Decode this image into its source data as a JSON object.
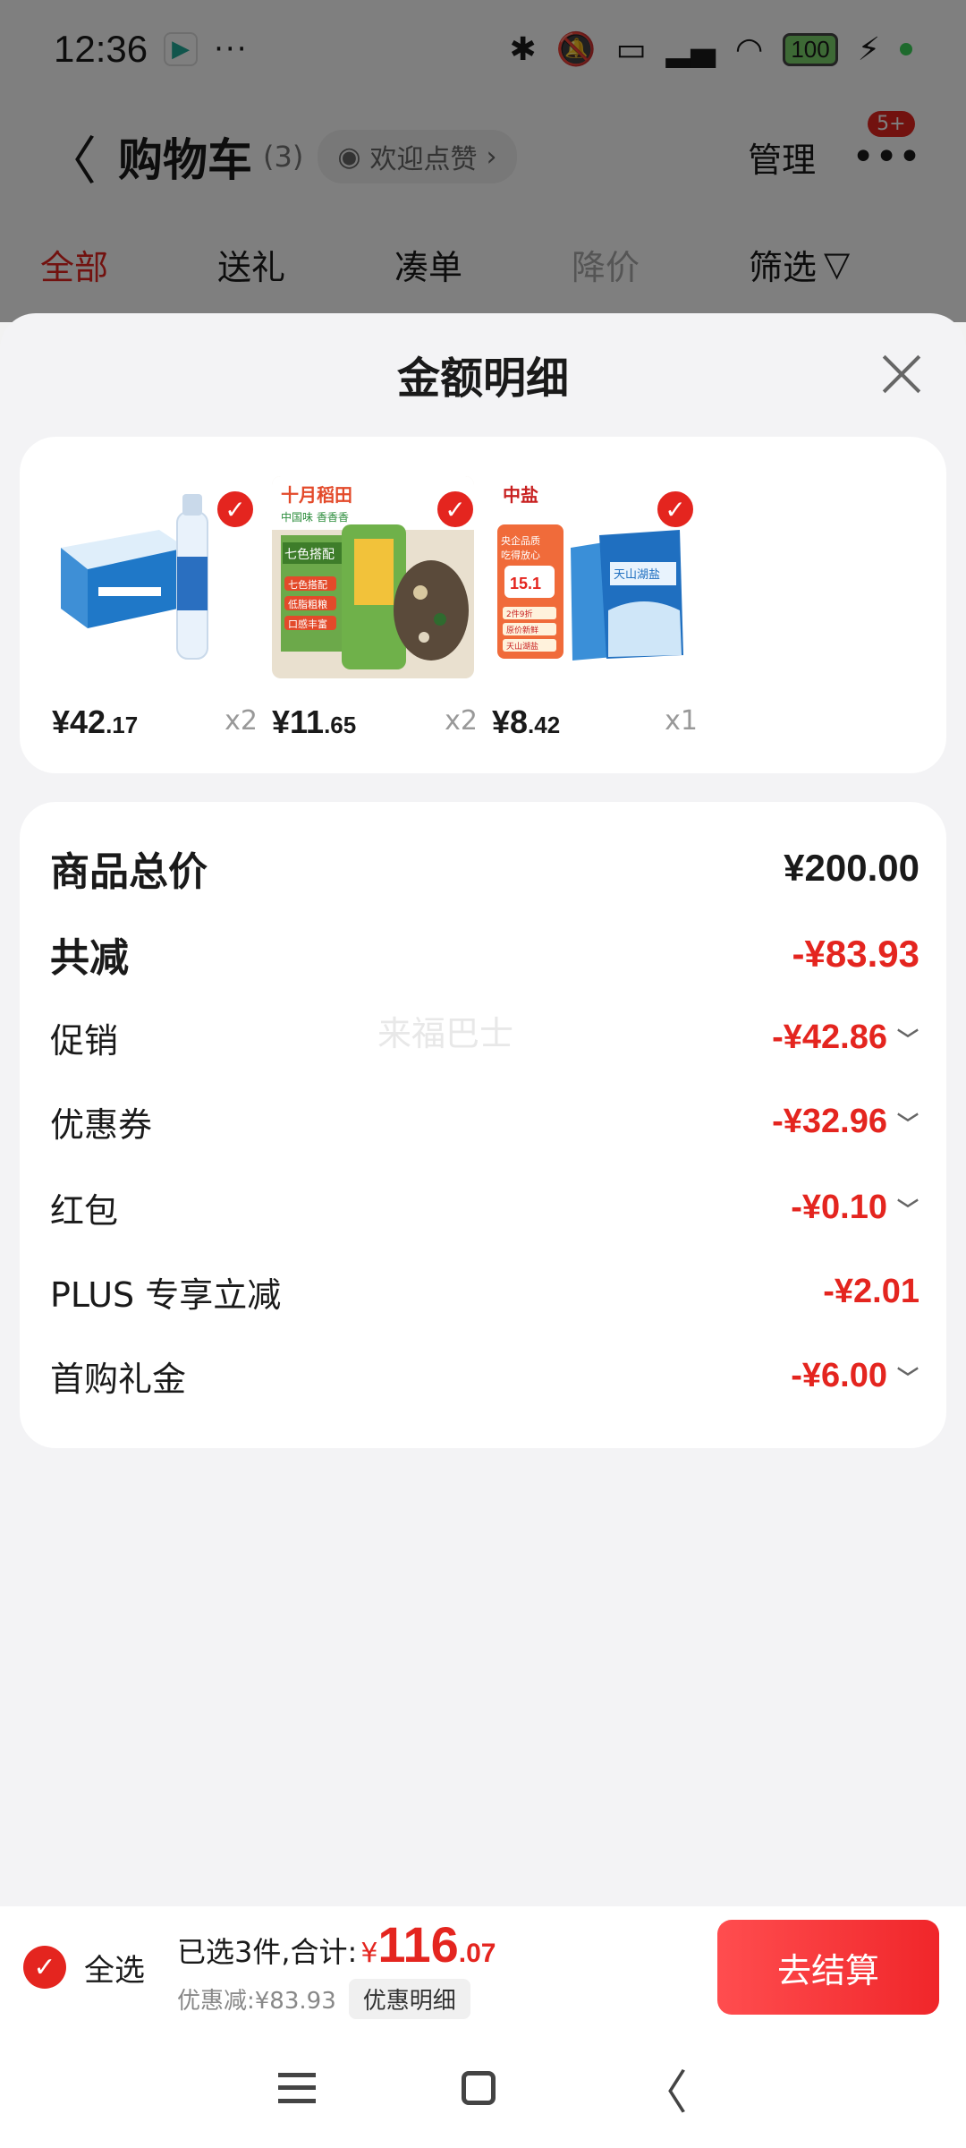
{
  "status_bar": {
    "time": "12:36",
    "dots": "···",
    "battery": "100"
  },
  "nav": {
    "title": "购物车",
    "count": "(3)",
    "like_pill": "欢迎点赞",
    "manage": "管理",
    "badge": "5+"
  },
  "filter_tabs": [
    "全部",
    "送礼",
    "凑单",
    "降价",
    "筛选"
  ],
  "sheet": {
    "title": "金额明细"
  },
  "products": [
    {
      "price_int": "¥42",
      "price_dec": ".17",
      "qty": "x2",
      "image": "water-box-and-bottle"
    },
    {
      "price_int": "¥11",
      "price_dec": ".65",
      "qty": "x2",
      "image": "rice-bag",
      "image_text": {
        "brand": "十月稻田",
        "tagline": "中国味 香香香",
        "tag": "七色搭配",
        "points": [
          "七色搭配",
          "低脂粗粮",
          "口感丰富"
        ]
      }
    },
    {
      "price_int": "¥8",
      "price_dec": ".42",
      "qty": "x1",
      "image": "salt-pack",
      "image_text": {
        "brand": "中盐",
        "line1": "央企品质",
        "line2": "吃得放心",
        "deal": "15.1",
        "tags": [
          "2件9折",
          "原价新鲜",
          "天山湖盐"
        ],
        "product": "天山湖盐"
      }
    }
  ],
  "summary": {
    "rows": [
      {
        "label": "商品总价",
        "value": "¥200.00",
        "style": "total",
        "chevron": false
      },
      {
        "label": "共减",
        "value": "-¥83.93",
        "style": "reduce",
        "chevron": false
      },
      {
        "label": "促销",
        "value": "-¥42.86",
        "style": "item",
        "chevron": true
      },
      {
        "label": "优惠券",
        "value": "-¥32.96",
        "style": "item",
        "chevron": true
      },
      {
        "label": "红包",
        "value": "-¥0.10",
        "style": "item",
        "chevron": true
      },
      {
        "label": "PLUS 专享立减",
        "value": "-¥2.01",
        "style": "item",
        "chevron": false
      },
      {
        "label": "首购礼金",
        "value": "-¥6.00",
        "style": "item",
        "chevron": true
      }
    ],
    "watermark": "来福巴士"
  },
  "bottom_bar": {
    "select_all": "全选",
    "selected_text": "已选3件,合计:",
    "currency": "¥",
    "total_int": "116",
    "total_dec": ".07",
    "discount_text": "优惠减:¥83.93",
    "discount_detail": "优惠明细",
    "checkout": "去结算"
  },
  "colors": {
    "accent": "#e4251f",
    "sheet_bg": "#f3f3f5"
  }
}
